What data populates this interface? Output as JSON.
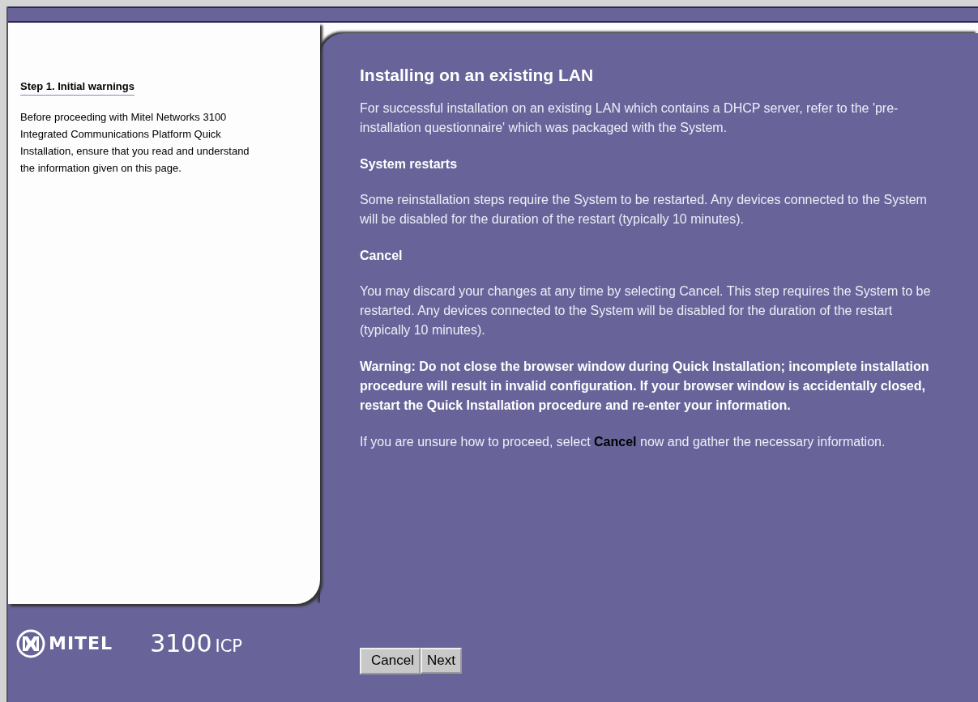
{
  "sidebar": {
    "title": "Step 1. Initial warnings",
    "text": "Before proceeding with Mitel Networks 3100 Integrated Communications Platform Quick Installation, ensure that you read and understand the information given on this page."
  },
  "content": {
    "title": "Installing on an existing LAN",
    "blocks": [
      {
        "kind": "text",
        "text": "For successful installation on an existing LAN which contains a DHCP server, refer to the 'pre-installation questionnaire' which was packaged with the System."
      },
      {
        "kind": "heading",
        "text": "System restarts"
      },
      {
        "kind": "text",
        "text": "Some reinstallation steps require the System to be restarted. Any devices connected to the System will be disabled for the duration of the restart (typically 10 minutes)."
      },
      {
        "kind": "heading",
        "text": "Cancel"
      },
      {
        "kind": "text",
        "text": "You may discard your changes at any time by selecting Cancel. This step requires the System to be restarted. Any devices connected to the System will be disabled for the duration of the restart (typically 10 minutes)."
      },
      {
        "kind": "warning",
        "text": "Warning: Do not close the browser window during Quick Installation; incomplete installation procedure will result in invalid configuration. If your browser window is accidentally closed, restart the Quick Installation procedure and re-enter your information."
      },
      {
        "kind": "text",
        "text": "If you are unsure how to proceed, select **Cancel** now and gather the necessary information."
      }
    ]
  },
  "footer": {
    "brand": "MITEL",
    "product_number": "3100",
    "product_suffix": "ICP",
    "buttons": [
      "Cancel",
      "Next"
    ]
  }
}
